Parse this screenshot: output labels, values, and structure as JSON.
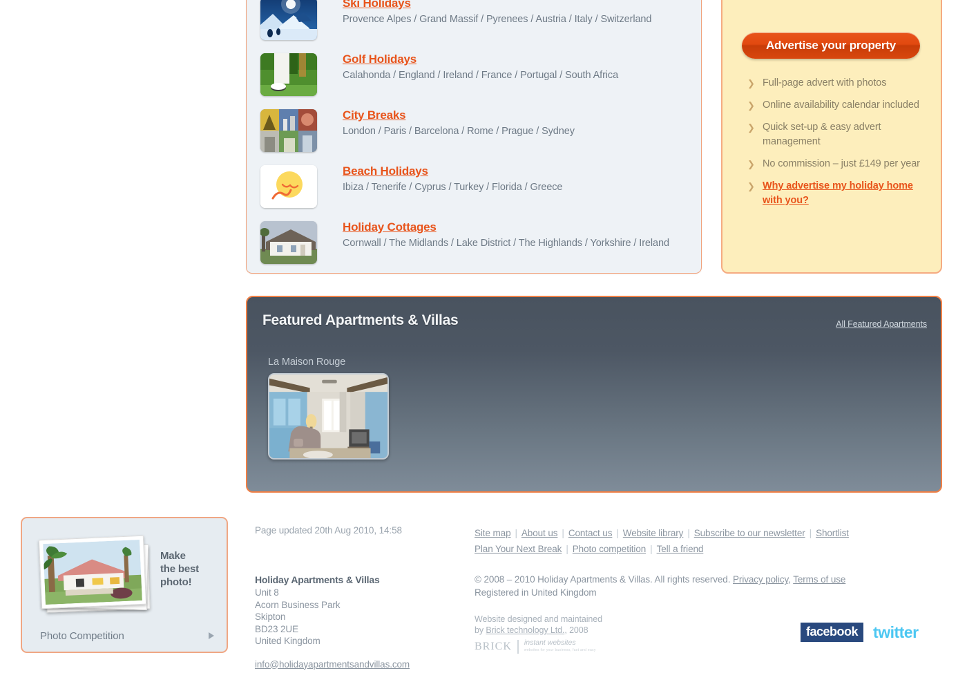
{
  "holiday_types": {
    "items": [
      {
        "title": "Ski Holidays",
        "locations": "Provence Alpes / Grand Massif / Pyrenees / Austria / Italy / Switzerland",
        "thumb": "ski-slope-thumbnail"
      },
      {
        "title": "Golf Holidays",
        "locations": "Calahonda / England / Ireland / France / Portugal / South Africa",
        "thumb": "golf-thumbnail"
      },
      {
        "title": "City Breaks",
        "locations": "London / Paris / Barcelona / Rome / Prague / Sydney",
        "thumb": "city-collage-thumbnail"
      },
      {
        "title": "Beach Holidays",
        "locations": "Ibiza / Tenerife / Cyprus / Turkey / Florida / Greece",
        "thumb": "sun-beach-thumbnail"
      },
      {
        "title": "Holiday Cottages",
        "locations": "Cornwall / The Midlands / Lake District / The Highlands / Yorkshire / Ireland",
        "thumb": "cottage-thumbnail"
      }
    ]
  },
  "advert_panel": {
    "button_label": "Advertise your property",
    "bullets": [
      {
        "text": "Full-page advert with photos",
        "is_link": false
      },
      {
        "text": "Online availability calendar included",
        "is_link": false
      },
      {
        "text": "Quick set-up & easy advert management",
        "is_link": false
      },
      {
        "text": "No commission – just £149 per year",
        "is_link": false
      },
      {
        "text": "Why advertise my holiday home with you?",
        "is_link": true
      }
    ],
    "background_color": "#fdeebc",
    "border_color": "#f5ab82",
    "button_color": "#e2490f"
  },
  "featured": {
    "title": "Featured Apartments & Villas",
    "all_link": "All Featured Apartments",
    "items": [
      {
        "name": "La Maison Rouge",
        "thumb": "living-room-photo"
      }
    ],
    "panel_gradient_top": "#49535f",
    "panel_gradient_bottom": "#7f8c99",
    "border_color": "#ef7f45"
  },
  "photo_competition": {
    "tagline": "Make\nthe best\nphoto!",
    "tagline_lines": [
      "Make",
      "the best",
      "photo!"
    ],
    "label": "Photo Competition",
    "arrow_icon": "play-arrow-icon",
    "border_color": "#f0a784"
  },
  "footer": {
    "page_updated": "Page updated 20th Aug 2010, 14:58",
    "company_name": "Holiday Apartments & Villas",
    "address_lines": [
      "Unit 8",
      "Acorn Business Park",
      "Skipton",
      "BD23 2UE",
      "United Kingdom"
    ],
    "email": "info@holidayapartmentsandvillas.com",
    "links_row1": [
      "Site map",
      "About us",
      "Contact us",
      "Website library",
      "Subscribe to our newsletter",
      "Shortlist"
    ],
    "links_row2": [
      "Plan Your Next Break",
      "Photo competition",
      "Tell a friend"
    ],
    "copyright_text": "© 2008 – 2010 Holiday Apartments & Villas. All rights reserved.",
    "privacy_link": "Privacy policy",
    "terms_link": "Terms of use",
    "registered": "Registered in United Kingdom",
    "design_prefix": "Website designed and maintained",
    "design_by": "by",
    "design_company": "Brick technology Ltd.",
    "design_year": ", 2008",
    "brick_word": "BRICK",
    "brick_tagline": "instant websites",
    "brick_subtagline": "websites for your business, fast and easy",
    "facebook_label": "facebook",
    "twitter_label": "twitter"
  }
}
